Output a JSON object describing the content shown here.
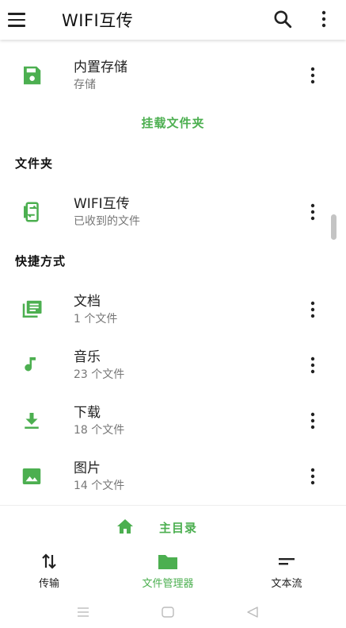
{
  "appbar": {
    "title": "WIFI互传"
  },
  "storage": {
    "name": "内置存储",
    "sub": "存储",
    "mount_label": "挂载文件夹"
  },
  "folders": {
    "header": "文件夹",
    "items": [
      {
        "name": "WIFI互传",
        "sub": "已收到的文件"
      }
    ]
  },
  "shortcuts": {
    "header": "快捷方式",
    "items": [
      {
        "name": "文档",
        "sub": "1 个文件",
        "icon": "documents-icon"
      },
      {
        "name": "音乐",
        "sub": "23 个文件",
        "icon": "music-note-icon"
      },
      {
        "name": "下载",
        "sub": "18 个文件",
        "icon": "download-icon"
      },
      {
        "name": "图片",
        "sub": "14 个文件",
        "icon": "image-icon"
      }
    ]
  },
  "home": {
    "label": "主目录"
  },
  "bottom_nav": {
    "items": [
      {
        "label": "传输",
        "icon": "transfer-arrows-icon",
        "active": false
      },
      {
        "label": "文件管理器",
        "icon": "folder-icon",
        "active": true
      },
      {
        "label": "文本流",
        "icon": "text-lines-icon",
        "active": false
      }
    ]
  },
  "colors": {
    "accent": "#4caf50",
    "text": "#222222",
    "subtext": "#777777"
  }
}
